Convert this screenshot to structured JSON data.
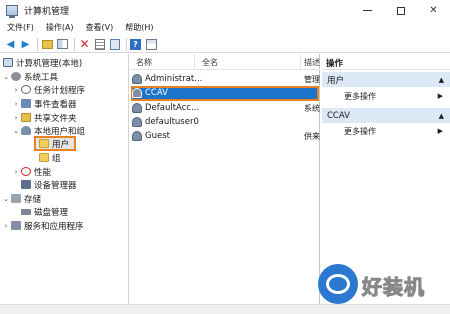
{
  "window": {
    "title": "计算机管理"
  },
  "menu": [
    "文件(F)",
    "操作(A)",
    "查看(V)",
    "帮助(H)"
  ],
  "tree": {
    "root": "计算机管理(本地)",
    "system_tools": "系统工具",
    "task_scheduler": "任务计划程序",
    "event_viewer": "事件查看器",
    "shared_folders": "共享文件夹",
    "local_users_groups": "本地用户和组",
    "users": "用户",
    "groups": "组",
    "performance": "性能",
    "device_manager": "设备管理器",
    "storage": "存储",
    "disk_management": "磁盘管理",
    "services_apps": "服务和应用程序"
  },
  "list": {
    "columns": [
      "名称",
      "全名",
      "描述"
    ],
    "rows": [
      {
        "name": "Administrat...",
        "desc": "管理"
      },
      {
        "name": "CCAV",
        "desc": ""
      },
      {
        "name": "DefaultAcc...",
        "desc": "系统"
      },
      {
        "name": "defaultuser0",
        "desc": ""
      },
      {
        "name": "Guest",
        "desc": "供来"
      }
    ]
  },
  "actions": {
    "title": "操作",
    "group1": {
      "header": "用户",
      "item": "更多操作"
    },
    "group2": {
      "header": "CCAV",
      "item": "更多操作"
    }
  },
  "watermark": {
    "text": "好装机"
  },
  "colors": {
    "selection": "#1b74c9",
    "highlight_border": "#e8821e",
    "action_header": "#dbe8f5"
  }
}
